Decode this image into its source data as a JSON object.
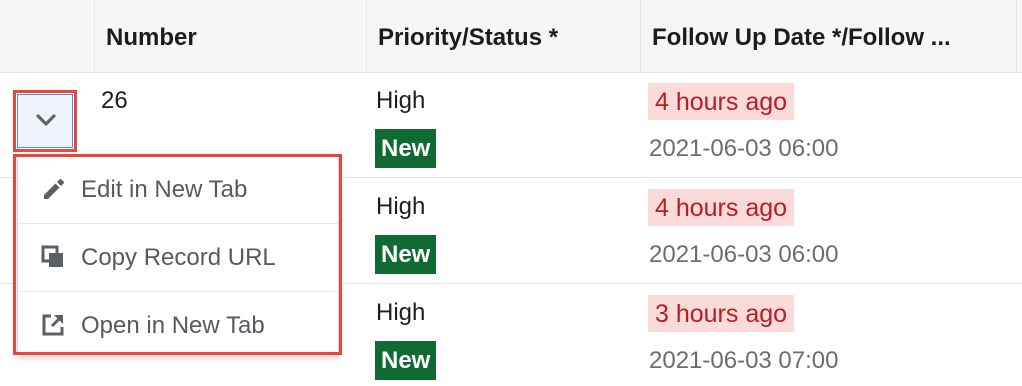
{
  "table": {
    "columns": [
      {
        "label": ""
      },
      {
        "label": "Number"
      },
      {
        "label": "Priority/Status *"
      },
      {
        "label": "Follow Up Date */Follow ..."
      }
    ],
    "rows": [
      {
        "number": "26",
        "priority": "High",
        "status": "New",
        "relative_time": "4 hours ago",
        "date": "2021-06-03 06:00"
      },
      {
        "number": "",
        "priority": "High",
        "status": "New",
        "relative_time": "4 hours ago",
        "date": "2021-06-03 06:00"
      },
      {
        "number": "",
        "priority": "High",
        "status": "New",
        "relative_time": "3 hours ago",
        "date": "2021-06-03 07:00"
      }
    ]
  },
  "row_actions": {
    "toggle_icon": "chevron-down-icon",
    "menu": [
      {
        "label": "Edit in New Tab",
        "icon": "pencil-icon"
      },
      {
        "label": "Copy Record URL",
        "icon": "copy-icon"
      },
      {
        "label": "Open in New Tab",
        "icon": "external-link-icon"
      }
    ]
  },
  "colors": {
    "highlight": "#e6493a",
    "status_new_bg": "#0f6b32",
    "overdue_bg": "#fbdada",
    "overdue_text": "#bb1c24"
  }
}
